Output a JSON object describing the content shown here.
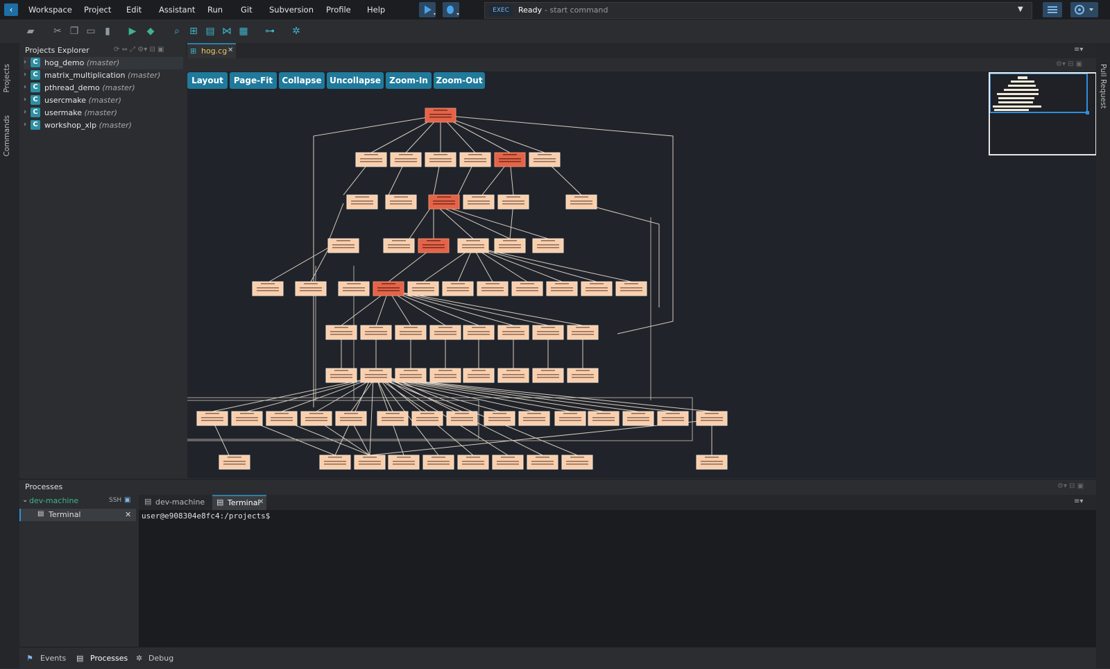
{
  "menu": [
    "Workspace",
    "Project",
    "Edit",
    "Assistant",
    "Run",
    "Git",
    "Subversion",
    "Profile",
    "Help"
  ],
  "exec": {
    "label": "EXEC",
    "status": "Ready",
    "hint": "- start command"
  },
  "explorer": {
    "title": "Projects Explorer",
    "projects": [
      {
        "name": "hog_demo",
        "branch": "(master)"
      },
      {
        "name": "matrix_multiplication",
        "branch": "(master)"
      },
      {
        "name": "pthread_demo",
        "branch": "(master)"
      },
      {
        "name": "usercmake",
        "branch": "(master)"
      },
      {
        "name": "usermake",
        "branch": "(master)"
      },
      {
        "name": "workshop_xlp",
        "branch": "(master)"
      }
    ]
  },
  "sidetabs": {
    "projects": "Projects",
    "commands": "Commands",
    "pull_request": "Pull Request"
  },
  "editor": {
    "tab": "hog.cg"
  },
  "graph_buttons": [
    "Layout",
    "Page-Fit",
    "Collapse",
    "Uncollapse",
    "Zoom-In",
    "Zoom-Out"
  ],
  "processes": {
    "title": "Processes",
    "machine": "dev-machine",
    "ssh": "SSH",
    "terminal_item": "Terminal",
    "tabs": [
      {
        "label": "dev-machine"
      },
      {
        "label": "Terminal"
      }
    ],
    "prompt": "user@e908304e8fc4:/projects$"
  },
  "status": {
    "events": "Events",
    "processes": "Processes",
    "debug": "Debug"
  },
  "colors": {
    "accent": "#1f7a9c",
    "node_light": "#f9cfae",
    "node_hot": "#e3644a",
    "edge": "#d6cfc0"
  }
}
